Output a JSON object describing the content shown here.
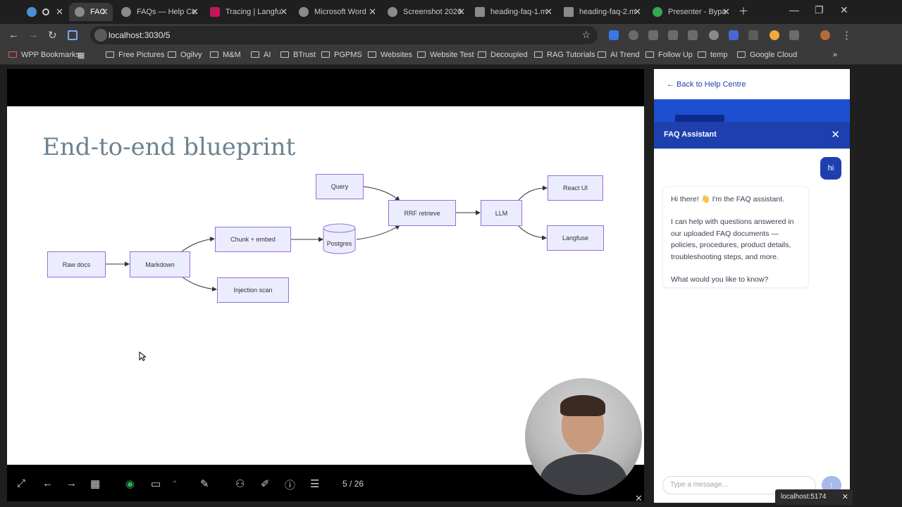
{
  "browser": {
    "tabs": [
      {
        "label": "",
        "favicon_color": "#4a90d9"
      },
      {
        "label": "FAC",
        "favicon_color": "#8a8a8a",
        "active": true
      },
      {
        "label": "FAQs — Help Ce",
        "favicon_color": "#8a8a8a"
      },
      {
        "label": "Tracing | Langfu",
        "favicon_color": "#c2185b"
      },
      {
        "label": "Microsoft Word",
        "favicon_color": "#8a8a8a"
      },
      {
        "label": "Screenshot 2026",
        "favicon_color": "#8a8a8a"
      },
      {
        "label": "heading-faq-1.m",
        "favicon_color": "#8a8a8a"
      },
      {
        "label": "heading-faq-2.m",
        "favicon_color": "#8a8a8a"
      },
      {
        "label": "Presenter - Bypa",
        "favicon_color": "#34a853"
      }
    ],
    "url": "localhost:3030/5",
    "bookmarks": [
      "WPP Bookmarks",
      "Free Pictures",
      "Ogilvy",
      "M&M",
      "AI",
      "BTrust",
      "PGPMS",
      "Websites",
      "Website Test",
      "Decoupled",
      "RAG Tutorials",
      "AI Trend",
      "Follow Up",
      "temp",
      "Google Cloud"
    ]
  },
  "slide": {
    "title": "End-to-end blueprint",
    "nodes": {
      "raw_docs": "Raw docs",
      "markdown": "Markdown",
      "chunk_embed": "Chunk + embed",
      "injection_scan": "Injection scan",
      "postgres": "Postgres",
      "query": "Query",
      "rrf_retrieve": "RRF retrieve",
      "llm": "LLM",
      "react_ui": "React UI",
      "langfuse": "Langfuse"
    },
    "counter": "5 / 26"
  },
  "panel": {
    "back_link": "← Back to Help Centre",
    "chat_title": "FAQ Assistant",
    "user_message": "hi",
    "bot_message": [
      "Hi there! 👋 I'm the FAQ assistant.",
      "I can help with questions answered in our uploaded FAQ documents — policies, procedures, product details, troubleshooting steps, and more.",
      "What would you like to know?"
    ],
    "input_placeholder": "Type a message..."
  },
  "toast": {
    "text": "localhost:5174"
  },
  "colors": {
    "accent": "#1e40af",
    "node_fill": "#ececff",
    "node_border": "#9370db"
  }
}
